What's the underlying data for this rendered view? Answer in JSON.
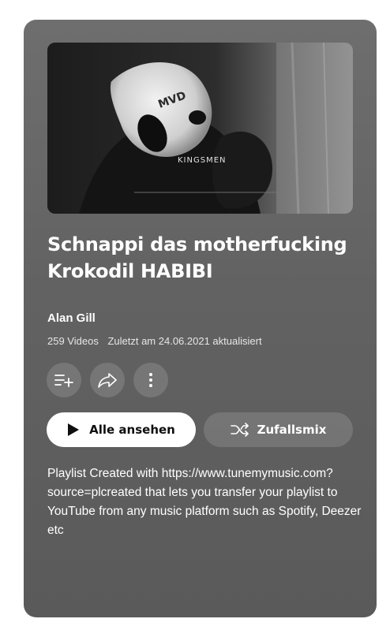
{
  "playlist": {
    "title": "Schnappi das motherfucking Krokodil HABIBI",
    "owner": "Alan Gill",
    "video_count": "259 Videos",
    "updated": "Zuletzt am 24.06.2021 aktualisiert",
    "description": "Playlist Created with https://www.tunemymusic.com?source=plcreated that lets you transfer your playlist to YouTube from any music platform such as Spotify, Deezer etc"
  },
  "thumbnail": {
    "watermark": "KINGSMEN",
    "mask_text": "MVD"
  },
  "actions": {
    "play_all": "Alle ansehen",
    "shuffle": "Zufallsmix"
  },
  "icons": {
    "add": "playlist-add-icon",
    "share": "share-icon",
    "more": "more-vert-icon",
    "play": "play-icon",
    "shuffle": "shuffle-icon"
  },
  "colors": {
    "card_background": "#636363",
    "text": "#ffffff",
    "button_primary_bg": "#ffffff",
    "button_primary_text": "#0f0f0f",
    "button_secondary_bg": "rgba(255,255,255,0.14)"
  }
}
